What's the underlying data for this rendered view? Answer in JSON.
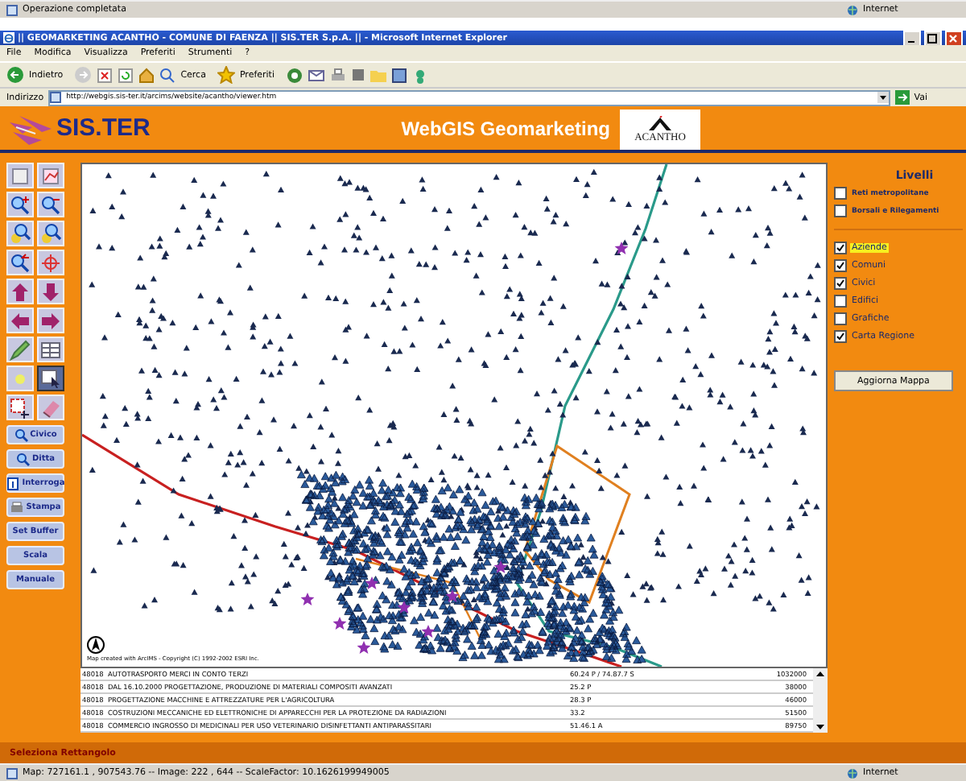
{
  "previous_window_status": {
    "text": "Operazione completata",
    "zone": "Internet"
  },
  "window": {
    "title": "|| GEOMARKETING ACANTHO - COMUNE DI FAENZA || SIS.TER S.p.A. || - Microsoft Internet Explorer"
  },
  "menu": [
    "File",
    "Modifica",
    "Visualizza",
    "Preferiti",
    "Strumenti",
    "?"
  ],
  "toolbar": {
    "back": "Indietro",
    "search": "Cerca",
    "favorites": "Preferiti"
  },
  "address": {
    "label": "Indirizzo",
    "url": "http://webgis.sis-ter.it/arcims/website/acantho/viewer.htm",
    "go": "Vai"
  },
  "header": {
    "logo": "SIS.TER",
    "title": "WebGIS Geomarketing",
    "partner": "ACANTHO"
  },
  "text_tools": [
    "Civico",
    "Ditta",
    "Interroga",
    "Stampa",
    "Set Buffer",
    "Scala",
    "Manuale"
  ],
  "map": {
    "copyright": "Map created with ArcIMS - Copyright (C) 1992-2002 ESRI Inc."
  },
  "layers": {
    "title": "Livelli",
    "groups": [
      {
        "label": "Reti metropolitane",
        "checked": false
      },
      {
        "label": "Borsali e Rilegamenti",
        "checked": false
      }
    ],
    "items": [
      {
        "label": "Aziende",
        "checked": true,
        "selected": true
      },
      {
        "label": "Comuni",
        "checked": true,
        "selected": false
      },
      {
        "label": "Civici",
        "checked": true,
        "selected": false
      },
      {
        "label": "Edifici",
        "checked": false,
        "selected": false
      },
      {
        "label": "Grafiche",
        "checked": false,
        "selected": false
      },
      {
        "label": "Carta Regione",
        "checked": true,
        "selected": false
      }
    ],
    "button": "Aggiorna Mappa"
  },
  "table": {
    "rows": [
      [
        "48018",
        "AUTOTRASPORTO MERCI IN CONTO TERZI",
        "60.24 P / 74.87.7 S",
        "1032000"
      ],
      [
        "48018",
        "DAL 16.10.2000 PROGETTAZIONE, PRODUZIONE DI MATERIALI COMPOSITI AVANZATI",
        "25.2 P",
        "38000"
      ],
      [
        "48018",
        "PROGETTAZIONE MACCHINE E ATTREZZATURE PER L'AGRICOLTURA",
        "28.3 P",
        "46000"
      ],
      [
        "48018",
        "COSTRUZIONI MECCANICHE ED ELETTRONICHE DI APPARECCHI PER LA PROTEZIONE DA RADIAZIONI",
        "33.2",
        "51500"
      ],
      [
        "48018",
        "COMMERCIO INGROSSO DI MEDICINALI PER USO VETERINARIO DISINFETTANTI ANTIPARASSITARI",
        "51.46.1 A",
        "89750"
      ]
    ]
  },
  "action_status": "Seleziona Rettangolo",
  "status_bar": {
    "text": "Map: 727161.1 , 907543.76 -- Image: 222 , 644 -- ScaleFactor: 10.1626199949005",
    "zone": "Internet"
  }
}
